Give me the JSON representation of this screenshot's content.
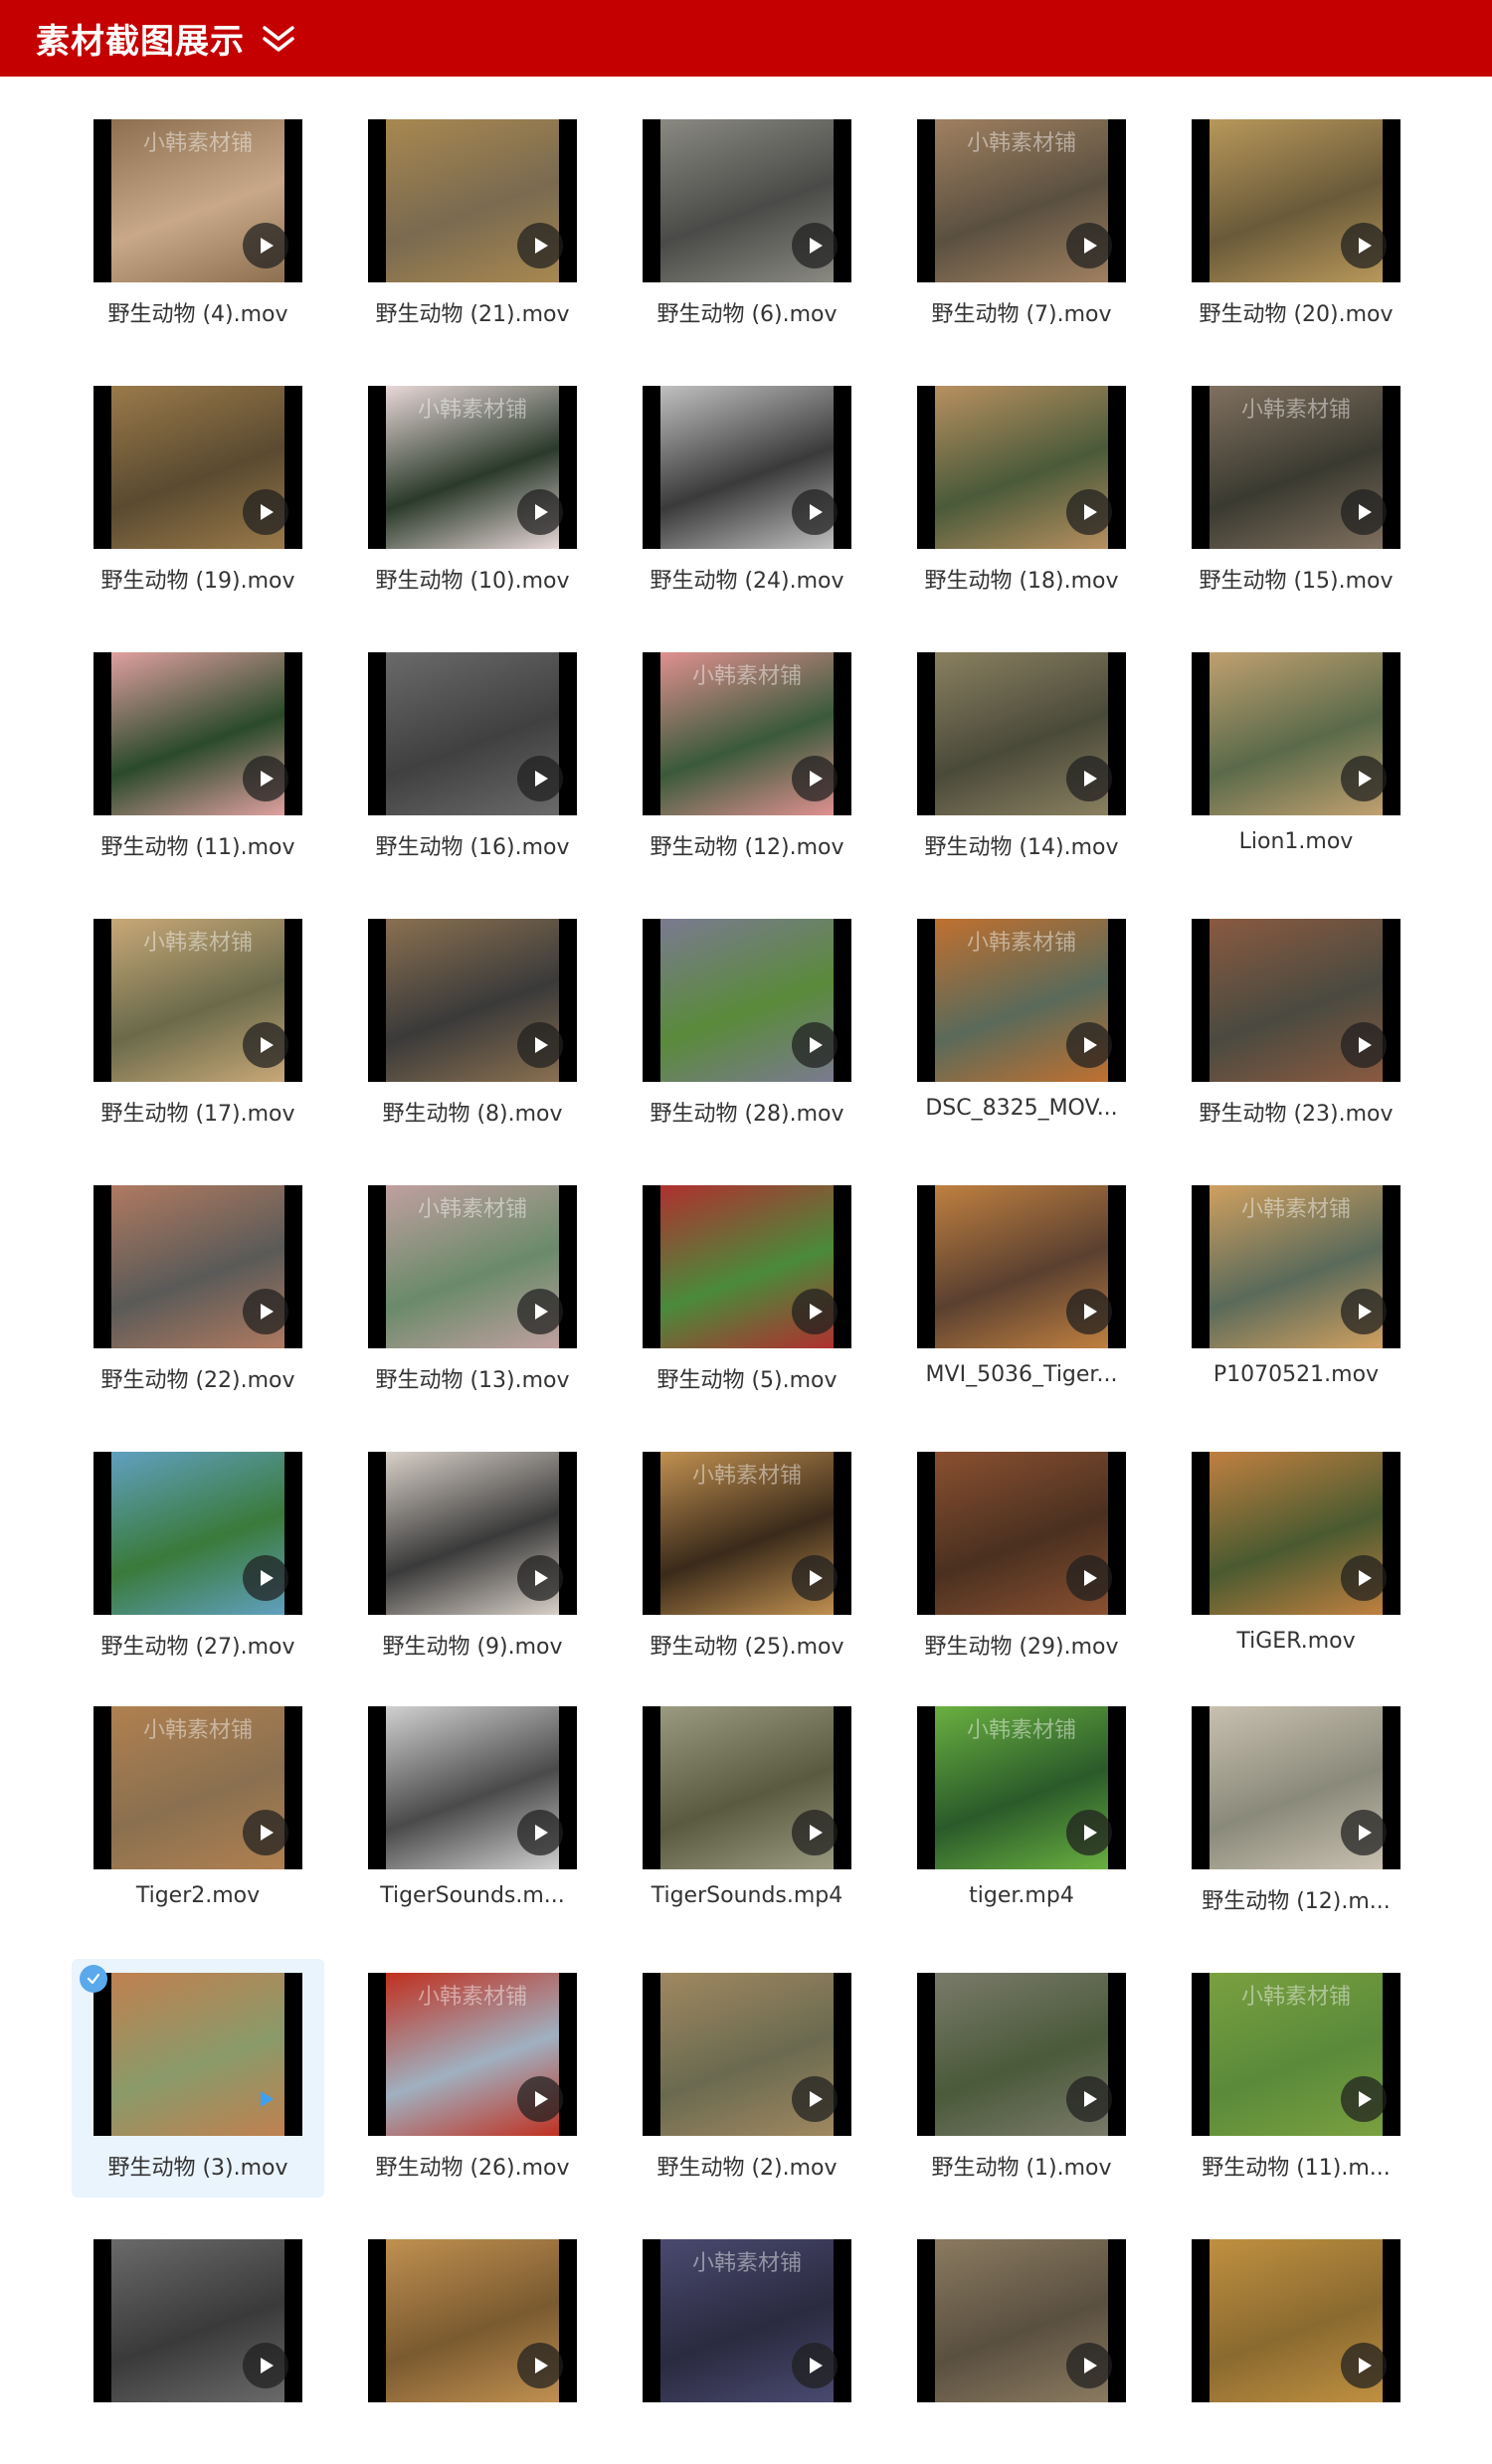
{
  "header": {
    "title": "素材截图展示",
    "chevron_icon": "double-chevron-down-icon",
    "bg_color": "#c40000"
  },
  "watermark_text": "小韩素材铺",
  "colors": {
    "selected_bg": "#eaf4fd",
    "check_badge": "#5aa9ec",
    "caption": "#333333",
    "active_play": "#3ea0f2"
  },
  "items": [
    {
      "caption": "野生动物 (4).mov",
      "colors": [
        "#c8a888",
        "#8d7050"
      ]
    },
    {
      "caption": "野生动物 (21).mov",
      "colors": [
        "#7a6a50",
        "#a88850"
      ]
    },
    {
      "caption": "野生动物 (6).mov",
      "colors": [
        "#4a4a48",
        "#8a8a82"
      ]
    },
    {
      "caption": "野生动物 (7).mov",
      "colors": [
        "#5a5040",
        "#a08060"
      ]
    },
    {
      "caption": "野生动物 (20).mov",
      "colors": [
        "#6a5a3a",
        "#b8985a"
      ]
    },
    {
      "caption": "野生动物 (19).mov",
      "colors": [
        "#5a4a30",
        "#9a7a4a"
      ]
    },
    {
      "caption": "野生动物 (10).mov",
      "colors": [
        "#2a3a2a",
        "#e8d8d8"
      ]
    },
    {
      "caption": "野生动物 (24).mov",
      "colors": [
        "#3a3a3a",
        "#c0c0c0"
      ]
    },
    {
      "caption": "野生动物 (18).mov",
      "colors": [
        "#4a5a3a",
        "#b89060"
      ]
    },
    {
      "caption": "野生动物 (15).mov",
      "colors": [
        "#3a3a30",
        "#807060"
      ]
    },
    {
      "caption": "野生动物 (11).mov",
      "colors": [
        "#2a4a2a",
        "#e0a0a0"
      ]
    },
    {
      "caption": "野生动物 (16).mov",
      "colors": [
        "#404040",
        "#6a6a6a"
      ]
    },
    {
      "caption": "野生动物 (12).mov",
      "colors": [
        "#3a5a3a",
        "#e09090"
      ]
    },
    {
      "caption": "野生动物 (14).mov",
      "colors": [
        "#4a4a3a",
        "#8a8060"
      ]
    },
    {
      "caption": "Lion1.mov",
      "colors": [
        "#5a6a4a",
        "#c0a070"
      ]
    },
    {
      "caption": "野生动物 (17).mov",
      "colors": [
        "#6a6a4a",
        "#c8a878"
      ]
    },
    {
      "caption": "野生动物 (8).mov",
      "colors": [
        "#3a3a3a",
        "#8a7050"
      ]
    },
    {
      "caption": "野生动物 (28).mov",
      "colors": [
        "#5a8a3a",
        "#7a7a90"
      ]
    },
    {
      "caption": "DSC_8325_MOV...",
      "colors": [
        "#5a6a5a",
        "#c07030"
      ]
    },
    {
      "caption": "野生动物 (23).mov",
      "colors": [
        "#4a4a40",
        "#8a5a40"
      ]
    },
    {
      "caption": "野生动物 (22).mov",
      "colors": [
        "#5a5a58",
        "#b07a60"
      ]
    },
    {
      "caption": "野生动物 (13).mov",
      "colors": [
        "#6a8a6a",
        "#c0a0a0"
      ]
    },
    {
      "caption": "野生动物 (5).mov",
      "colors": [
        "#4a8a3a",
        "#b03030"
      ]
    },
    {
      "caption": "MVI_5036_Tiger...",
      "colors": [
        "#5a4030",
        "#c08040"
      ]
    },
    {
      "caption": "P1070521.mov",
      "colors": [
        "#5a6a5a",
        "#d0a060"
      ]
    },
    {
      "caption": "野生动物 (27).mov",
      "colors": [
        "#3a7a3a",
        "#60a0c0"
      ]
    },
    {
      "caption": "野生动物 (9).mov",
      "colors": [
        "#3a3a3a",
        "#d8d0c8"
      ]
    },
    {
      "caption": "野生动物 (25).mov",
      "colors": [
        "#3a2a1a",
        "#c09050"
      ]
    },
    {
      "caption": "野生动物 (29).mov",
      "colors": [
        "#4a3020",
        "#8a5030"
      ]
    },
    {
      "caption": "TiGER.mov",
      "colors": [
        "#4a5a30",
        "#c08040"
      ]
    },
    {
      "caption": "Tiger2.mov",
      "colors": [
        "#8a7050",
        "#b08050"
      ]
    },
    {
      "caption": "TigerSounds.m...",
      "colors": [
        "#4a4a4a",
        "#d0d0d0"
      ]
    },
    {
      "caption": "TigerSounds.mp4",
      "colors": [
        "#5a5a40",
        "#9a9a80"
      ]
    },
    {
      "caption": "tiger.mp4",
      "colors": [
        "#2a5a2a",
        "#6ab040"
      ]
    },
    {
      "caption": "野生动物 (12).m...",
      "colors": [
        "#8a8a7a",
        "#c8c0b0"
      ]
    },
    {
      "caption": "野生动物 (3).mov",
      "colors": [
        "#8a9a6a",
        "#c08050"
      ],
      "selected": true
    },
    {
      "caption": "野生动物 (26).mov",
      "colors": [
        "#a0b0c0",
        "#c03020"
      ]
    },
    {
      "caption": "野生动物 (2).mov",
      "colors": [
        "#6a6a50",
        "#a08860"
      ]
    },
    {
      "caption": "野生动物 (1).mov",
      "colors": [
        "#4a5a3a",
        "#7a7a6a"
      ]
    },
    {
      "caption": "野生动物 (11).m...",
      "colors": [
        "#5a8a3a",
        "#7aa040"
      ]
    },
    {
      "caption": "",
      "colors": [
        "#3a3a3a",
        "#6a6a6a"
      ]
    },
    {
      "caption": "",
      "colors": [
        "#7a5a30",
        "#c09050"
      ]
    },
    {
      "caption": "",
      "colors": [
        "#2a2a40",
        "#4a4a70"
      ]
    },
    {
      "caption": "",
      "colors": [
        "#5a5040",
        "#8a7a60"
      ]
    },
    {
      "caption": "",
      "colors": [
        "#8a6a30",
        "#c09040"
      ]
    }
  ]
}
